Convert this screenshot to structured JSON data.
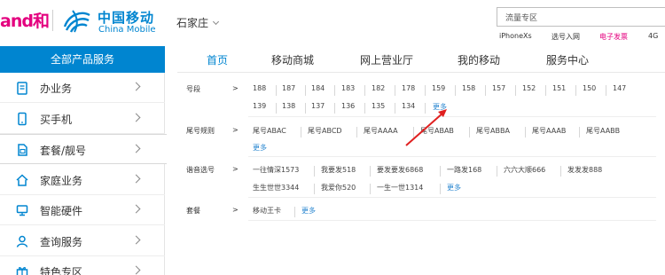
{
  "header": {
    "brand_and": "and和",
    "logo_cn": "中国移动",
    "logo_en": "China Mobile",
    "city": "石家庄",
    "search_placeholder": "流量专区",
    "hot_links": [
      "iPhoneXs",
      "选号入网",
      "电子发票",
      "4G"
    ],
    "hot_red_index": 2
  },
  "sidebar": {
    "title": "全部产品服务",
    "items": [
      {
        "label": "办业务",
        "icon": "clipboard-icon"
      },
      {
        "label": "买手机",
        "icon": "phone-icon"
      },
      {
        "label": "套餐/靓号",
        "icon": "sim-card-icon"
      },
      {
        "label": "家庭业务",
        "icon": "home-icon"
      },
      {
        "label": "智能硬件",
        "icon": "lightbulb-icon"
      },
      {
        "label": "查询服务",
        "icon": "user-icon"
      },
      {
        "label": "特色专区",
        "icon": "gift-icon"
      }
    ],
    "active_index": 2
  },
  "nav": {
    "tabs": [
      "首页",
      "移动商城",
      "网上营业厅",
      "我的移动",
      "服务中心"
    ],
    "active_index": 0
  },
  "filters": {
    "segment": {
      "label": "号段",
      "options_line1": [
        "188",
        "187",
        "184",
        "183",
        "182",
        "178",
        "159",
        "158",
        "157",
        "152",
        "151",
        "150",
        "147"
      ],
      "options_line2": [
        "139",
        "138",
        "137",
        "136",
        "135",
        "134"
      ],
      "more": "更多"
    },
    "tail": {
      "label": "尾号规则",
      "options": [
        "尾号ABAC",
        "尾号ABCD",
        "尾号AAAA",
        "尾号ABAB",
        "尾号ABBA",
        "尾号AAAB",
        "尾号AABB"
      ],
      "more": "更多"
    },
    "phonetic": {
      "label": "谐音选号",
      "options_line1": [
        "一往情深1573",
        "我要发518",
        "要发要发6868",
        "一路发168",
        "六六大顺666",
        "发发发888"
      ],
      "options_line2": [
        "生生世世3344",
        "我爱你520",
        "一生一世1314"
      ],
      "more": "更多"
    },
    "package": {
      "label": "套餐",
      "options": [
        "移动王卡"
      ],
      "more": "更多"
    },
    "gt": ">"
  },
  "colors": {
    "brand_blue": "#0085d0",
    "brand_magenta": "#e4007f",
    "link_blue": "#2a87d0",
    "annotation_red": "#e02020"
  }
}
